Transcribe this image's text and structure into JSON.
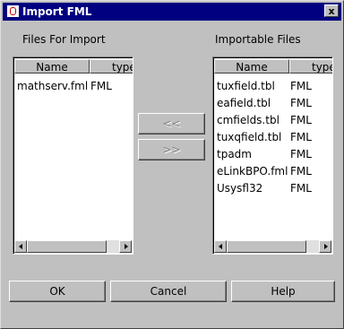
{
  "window": {
    "title": "Import FML",
    "close_glyph": "x"
  },
  "left_panel": {
    "label": "Files For Import",
    "columns": [
      "Name",
      "type"
    ],
    "rows": [
      {
        "name": "mathserv.fml",
        "type": "FML"
      }
    ]
  },
  "right_panel": {
    "label": "Importable Files",
    "columns": [
      "Name",
      "type"
    ],
    "rows": [
      {
        "name": "tuxfield.tbl",
        "type": "FML"
      },
      {
        "name": "eafield.tbl",
        "type": "FML"
      },
      {
        "name": "cmfields.tbl",
        "type": "FML"
      },
      {
        "name": "tuxqfield.tbl",
        "type": "FML"
      },
      {
        "name": "tpadm",
        "type": "FML"
      },
      {
        "name": "eLinkBPO.fml",
        "type": "FML"
      },
      {
        "name": "Usysfl32",
        "type": "FML"
      }
    ]
  },
  "transfer": {
    "add_label": "<<",
    "remove_label": ">>"
  },
  "buttons": {
    "ok": "OK",
    "cancel": "Cancel",
    "help": "Help"
  }
}
